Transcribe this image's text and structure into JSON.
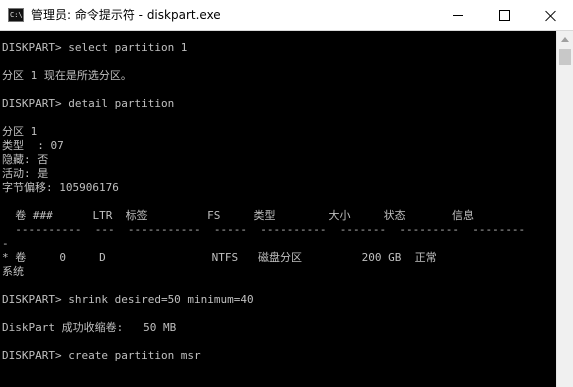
{
  "window": {
    "title": "管理员: 命令提示符 - diskpart.exe",
    "icon": "cmd-icon",
    "icon_text": "C:\\."
  },
  "controls": {
    "minimize": "minimize-icon",
    "maximize": "maximize-icon",
    "close": "close-icon"
  },
  "console": {
    "lines": [
      "DISKPART> select partition 1",
      "",
      "分区 1 现在是所选分区。",
      "",
      "DISKPART> detail partition",
      "",
      "分区 1",
      "类型  : 07",
      "隐藏: 否",
      "活动: 是",
      "字节偏移: 105906176",
      "",
      "  卷 ###      LTR  标签         FS     类型        大小     状态       信息",
      "  ----------  ---  -----------  -----  ----------  -------  ---------  --------",
      "-",
      "* 卷     0     D                NTFS   磁盘分区         200 GB  正常",
      "系统",
      "",
      "DISKPART> shrink desired=50 minimum=40",
      "",
      "DiskPart 成功收缩卷:   50 MB",
      "",
      "DISKPART> create partition msr"
    ]
  },
  "colors": {
    "console_bg": "#000000",
    "console_text": "#c0c0c0",
    "titlebar_bg": "#ffffff"
  }
}
